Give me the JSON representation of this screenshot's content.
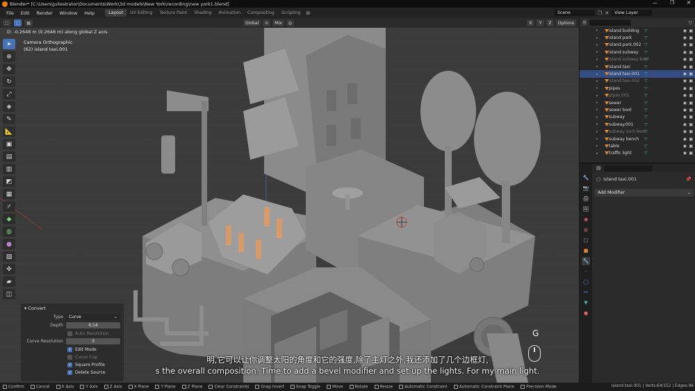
{
  "window": {
    "title": "Blender* [C:\\Users\\Juliestrator\\Documents\\Work\\3d models\\New York\\recording\\new york1.blend]",
    "controls": [
      "—",
      "❐",
      "✕"
    ]
  },
  "menubar": {
    "menus": [
      "File",
      "Edit",
      "Render",
      "Window",
      "Help"
    ],
    "workspaces": [
      "Layout",
      "UV Editing",
      "Texture Paint",
      "Shading",
      "Animation",
      "Compositing",
      "Scripting"
    ],
    "active_workspace": "Layout",
    "scene": "Scene",
    "view_layer": "View Layer"
  },
  "viewport_header": {
    "orientation": "Global",
    "pivot": "Mix",
    "axes": [
      "X",
      "Y",
      "Z"
    ],
    "options": "Options"
  },
  "viewport": {
    "status_text": "D: -0.2648 m (0.2648 m) along global Z axis",
    "view_name": "Camera Orthographic",
    "active_object": "(62) island taxi.001",
    "key_hint": "G"
  },
  "operator_panel": {
    "title": "Convert",
    "type_label": "Type",
    "type_value": "Curve",
    "depth_label": "Depth",
    "depth_value": "0.14",
    "auto_resolution": "Auto Resolution",
    "curve_resolution_label": "Curve Resolution",
    "curve_resolution_value": "3",
    "edit_mode": "Edit Mode",
    "curve_cap": "Curve Cap",
    "square_profile": "Square Profile",
    "delete_source": "Delete Source"
  },
  "subtitles": {
    "chinese": "明,它可以让你调整太阳的角度和它的强度,除了主灯之外,我还添加了几个边框灯,",
    "english": "s the overall composition. Time to add a bevel modifier and set up the lights. For my main light."
  },
  "outliner": {
    "items": [
      {
        "name": "island building",
        "dim": false,
        "selected": false
      },
      {
        "name": "island park",
        "dim": false,
        "selected": false
      },
      {
        "name": "island park.002",
        "dim": false,
        "selected": false
      },
      {
        "name": "island subway",
        "dim": false,
        "selected": false
      },
      {
        "name": "island subway bool",
        "dim": true,
        "selected": false
      },
      {
        "name": "island taxi",
        "dim": false,
        "selected": false
      },
      {
        "name": "island taxi.001",
        "dim": false,
        "selected": true
      },
      {
        "name": "island taxi.002",
        "dim": true,
        "selected": false
      },
      {
        "name": "pipes",
        "dim": false,
        "selected": false
      },
      {
        "name": "pipes.001",
        "dim": true,
        "selected": false
      },
      {
        "name": "sewer",
        "dim": false,
        "selected": false
      },
      {
        "name": "sewer bool",
        "dim": false,
        "selected": false
      },
      {
        "name": "subway",
        "dim": false,
        "selected": false
      },
      {
        "name": "subway.001",
        "dim": false,
        "selected": false
      },
      {
        "name": "subway arch bool",
        "dim": true,
        "selected": false
      },
      {
        "name": "subway bench",
        "dim": false,
        "selected": false
      },
      {
        "name": "table",
        "dim": false,
        "selected": false
      },
      {
        "name": "traffic light",
        "dim": false,
        "selected": false
      }
    ]
  },
  "properties": {
    "object_name": "island taxi.001",
    "add_modifier": "Add Modifier"
  },
  "statusbar": {
    "items": [
      "Confirm",
      "Cancel",
      "X Axis",
      "Y Axis",
      "Z Axis",
      "X Plane",
      "Y Plane",
      "Z Plane",
      "Clear Constraints",
      "Snap Invert",
      "Snap Toggle",
      "Move",
      "Rotate",
      "Resize",
      "Automatic Constraint",
      "Automatic Constraint Plane",
      "Precision Mode"
    ],
    "stats": "island taxi.001 | Verts:64/152 | Edges:96"
  },
  "colors": {
    "accent": "#4772b3",
    "selection": "#334d80",
    "object_orange": "#e38a3a",
    "modifier_teal": "#3fb6a8"
  }
}
